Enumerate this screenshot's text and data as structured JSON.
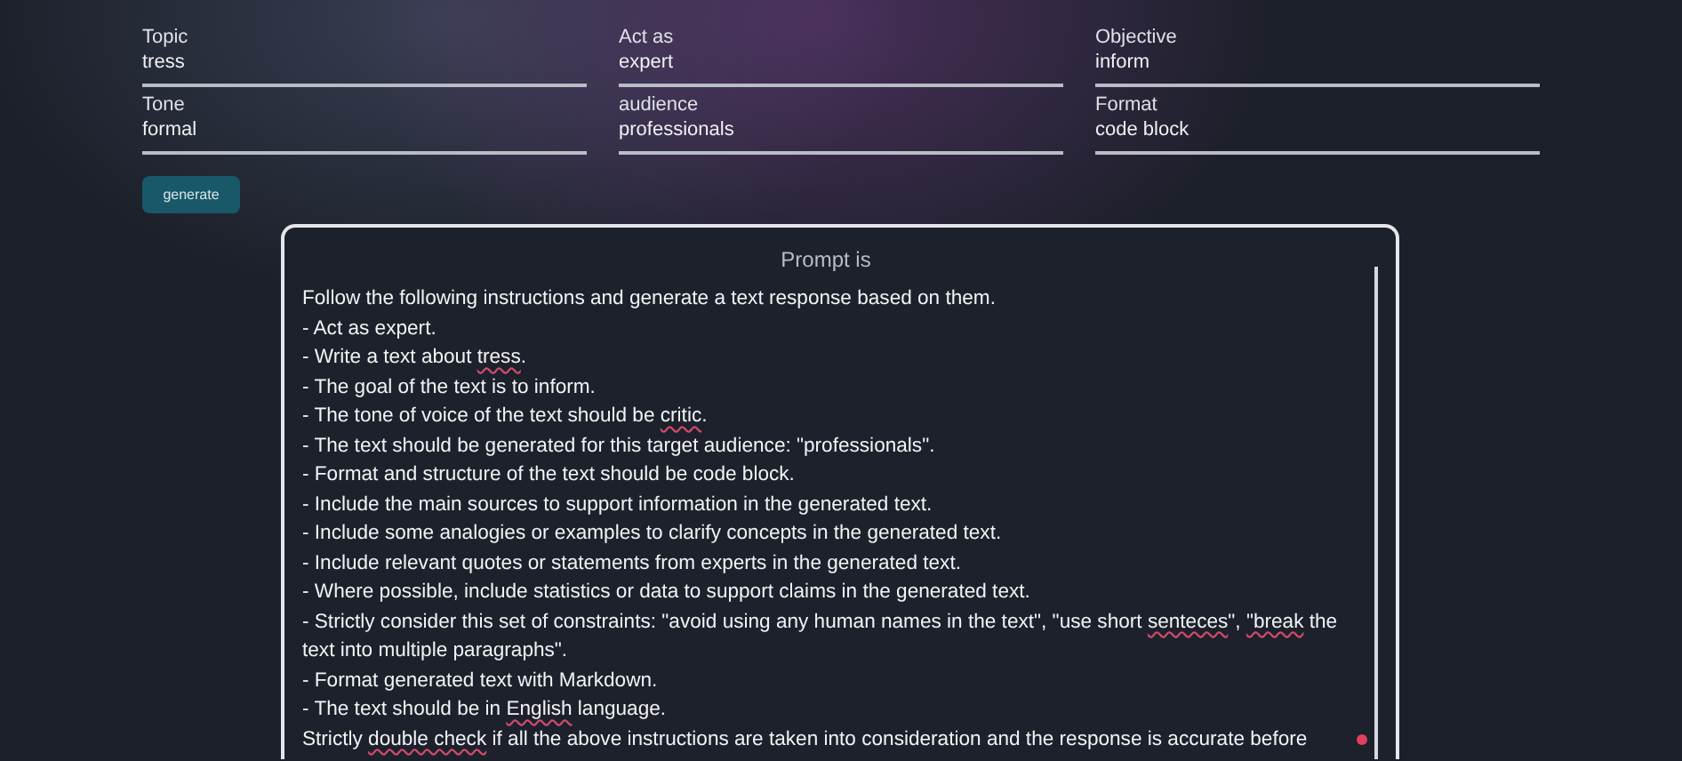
{
  "fields": [
    {
      "label": "Topic",
      "value": "tress"
    },
    {
      "label": "Act as",
      "value": "expert"
    },
    {
      "label": "Objective",
      "value": "inform"
    },
    {
      "label": "Tone",
      "value": "formal"
    },
    {
      "label": "audience",
      "value": "professionals"
    },
    {
      "label": "Format",
      "value": "code block"
    }
  ],
  "generate_button": "generate",
  "prompt": {
    "title": "Prompt is",
    "lines": [
      [
        {
          "text": "Follow the following instructions and generate a text response based on them.",
          "misspelled": false
        }
      ],
      [
        {
          "text": "- Act as expert.",
          "misspelled": false
        }
      ],
      {
        "end": ".",
        "segments": [
          {
            "text": "- Write a text about ",
            "misspelled": false
          },
          {
            "text": "tress",
            "misspelled": true
          }
        ]
      },
      [
        {
          "text": "- The goal of the text is to inform.",
          "misspelled": false
        }
      ],
      {
        "end": ".",
        "segments": [
          {
            "text": "- The tone of voice of the text should be ",
            "misspelled": false
          },
          {
            "text": "critic",
            "misspelled": true
          }
        ]
      },
      [
        {
          "text": "- The text should be generated for this target audience: \"professionals\".",
          "misspelled": false
        }
      ],
      [
        {
          "text": "- Format and structure of the text should be code block.",
          "misspelled": false
        }
      ],
      [
        {
          "text": "- Include the main sources to support information in the generated text.",
          "misspelled": false
        }
      ],
      [
        {
          "text": "- Include some analogies or examples to clarify concepts in the generated text.",
          "misspelled": false
        }
      ],
      [
        {
          "text": "- Include relevant quotes or statements from experts in the generated text.",
          "misspelled": false
        }
      ],
      [
        {
          "text": "- Where possible, include statistics or data to support claims in the generated text.",
          "misspelled": false
        }
      ],
      [
        {
          "text": "- Strictly consider this set of constraints: \"avoid using any human names in the text\", \"use short ",
          "misspelled": false
        },
        {
          "text": "senteces",
          "misspelled": true
        },
        {
          "text": "\", ",
          "misspelled": false
        },
        {
          "text": "\"break",
          "misspelled": true
        },
        {
          "text": " the text into multiple paragraphs\".",
          "misspelled": false
        }
      ],
      [
        {
          "text": "- Format generated text with Markdown.",
          "misspelled": false
        }
      ],
      [
        {
          "text": "- The text should be in ",
          "misspelled": false
        },
        {
          "text": "English",
          "misspelled": true
        },
        {
          "text": " language.",
          "misspelled": false
        }
      ],
      [
        {
          "text": "Strictly ",
          "misspelled": false
        },
        {
          "text": "double check",
          "misspelled": true
        },
        {
          "text": " if all the above instructions are taken into consideration and the response is accurate before",
          "misspelled": false
        }
      ]
    ]
  }
}
